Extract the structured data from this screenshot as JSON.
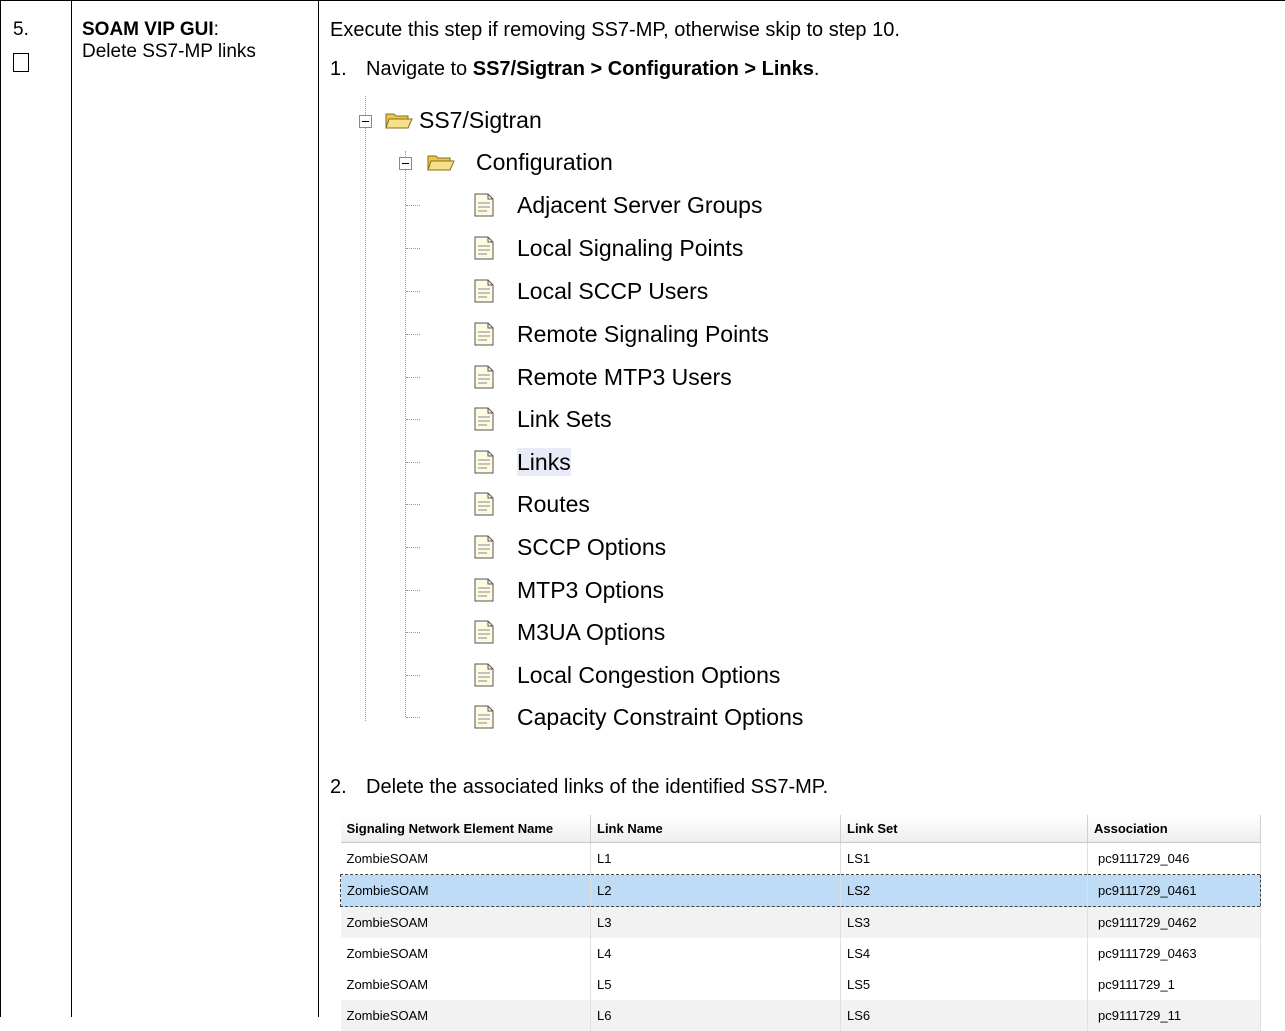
{
  "step": {
    "number": "5.",
    "title": "SOAM VIP GUI",
    "title_suffix": ":",
    "description": "Delete SS7-MP links"
  },
  "instructions": {
    "intro": "Execute this step if removing SS7-MP, otherwise skip to step 10.",
    "step1_num": "1.",
    "step1_text": "Navigate to ",
    "step1_path": "SS7/Sigtran > Configuration > Links",
    "step1_end": ".",
    "step2_num": "2.",
    "step2_text": "Delete the associated links of the identified SS7-MP."
  },
  "tree": {
    "root": "SS7/Sigtran",
    "child": "Configuration",
    "items": [
      "Adjacent Server Groups",
      "Local Signaling Points",
      "Local SCCP Users",
      "Remote Signaling Points",
      "Remote MTP3 Users",
      "Link Sets",
      "Links",
      "Routes",
      "SCCP Options",
      "MTP3 Options",
      "M3UA Options",
      "Local Congestion Options",
      "Capacity Constraint Options"
    ],
    "selected": "Links"
  },
  "grid": {
    "headers": [
      "Signaling Network Element Name",
      "Link Name",
      "Link Set",
      "Association"
    ],
    "rows": [
      [
        "ZombieSOAM",
        "L1",
        "LS1",
        "pc9111729_046"
      ],
      [
        "ZombieSOAM",
        "L2",
        "LS2",
        "pc9111729_0461"
      ],
      [
        "ZombieSOAM",
        "L3",
        "LS3",
        "pc9111729_0462"
      ],
      [
        "ZombieSOAM",
        "L4",
        "LS4",
        "pc9111729_0463"
      ],
      [
        "ZombieSOAM",
        "L5",
        "LS5",
        "pc9111729_1"
      ],
      [
        "ZombieSOAM",
        "L6",
        "LS6",
        "pc9111729_11"
      ]
    ],
    "selected_row": 2
  }
}
